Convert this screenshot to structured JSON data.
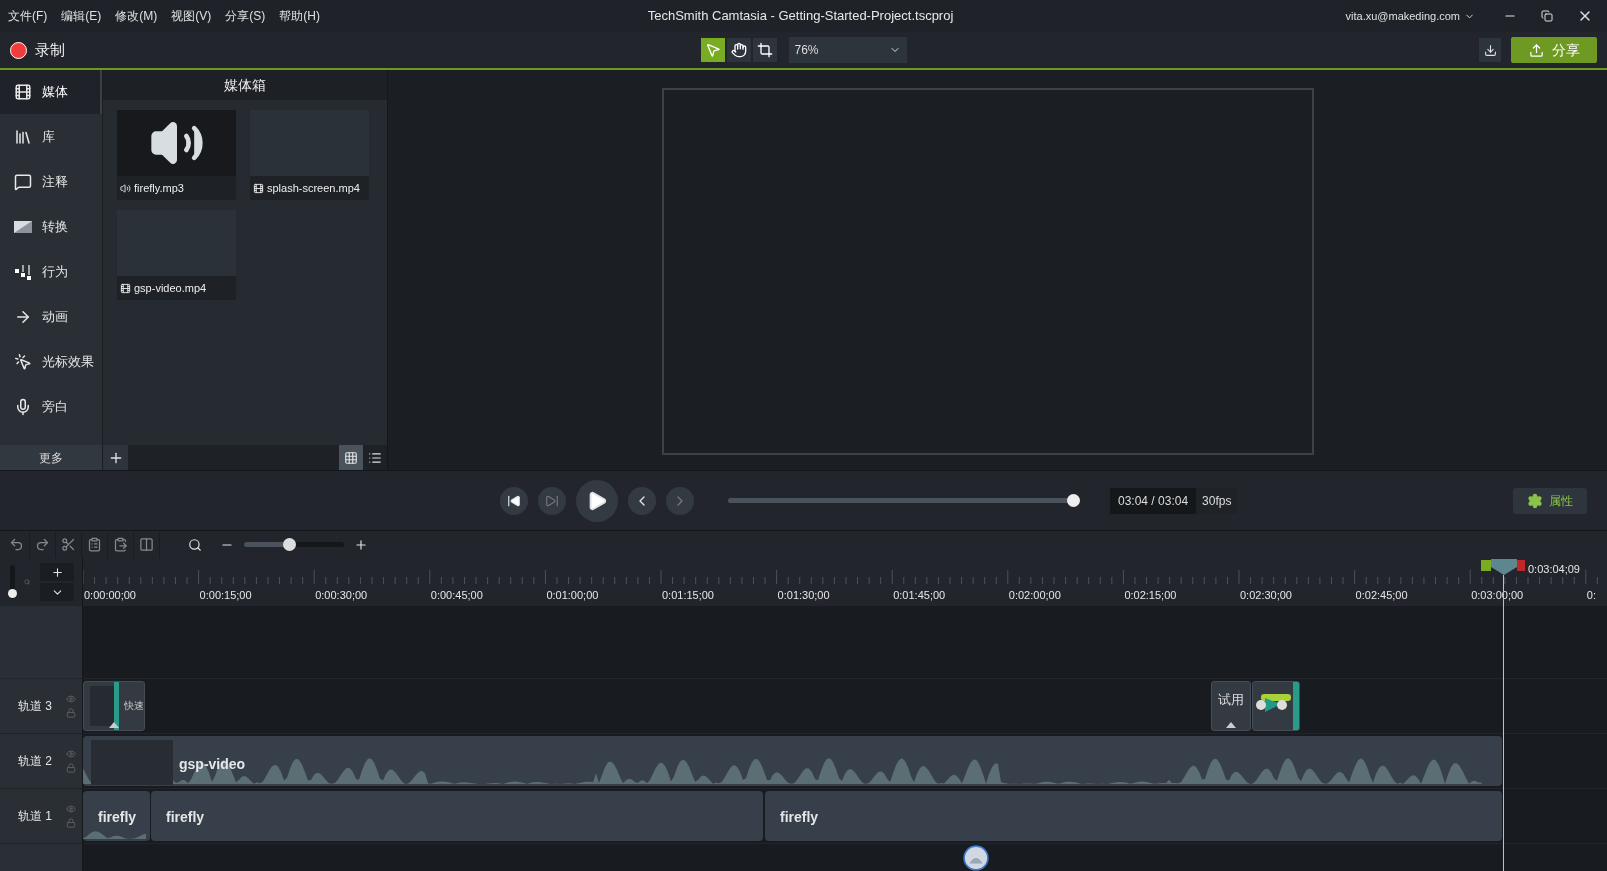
{
  "menu": [
    "文件(F)",
    "编辑(E)",
    "修改(M)",
    "视图(V)",
    "分享(S)",
    "帮助(H)"
  ],
  "window": {
    "title": "TechSmith Camtasia - Getting-Started-Project.tscproj",
    "account": "vita.xu@makeding.com"
  },
  "toolbar": {
    "record": "录制",
    "zoom": "76%",
    "share": "分享",
    "tools": [
      {
        "kind": "pointer",
        "selected": true
      },
      {
        "kind": "hand",
        "selected": false
      },
      {
        "kind": "crop",
        "selected": false
      }
    ]
  },
  "sidebar": {
    "items": [
      {
        "label": "媒体",
        "kind": "media",
        "selected": true
      },
      {
        "label": "库",
        "kind": "library",
        "selected": false
      },
      {
        "label": "注释",
        "kind": "annotation",
        "selected": false
      },
      {
        "label": "转换",
        "kind": "transition",
        "selected": false
      },
      {
        "label": "行为",
        "kind": "behavior",
        "selected": false
      },
      {
        "label": "动画",
        "kind": "animation",
        "selected": false
      },
      {
        "label": "光标效果",
        "kind": "cursor",
        "selected": false
      },
      {
        "label": "旁白",
        "kind": "narration",
        "selected": false
      }
    ],
    "more": "更多"
  },
  "media_bin": {
    "title": "媒体箱",
    "items": [
      {
        "name": "firefly.mp3",
        "kind": "audio"
      },
      {
        "name": "splash-screen.mp4",
        "kind": "video"
      },
      {
        "name": "gsp-video.mp4",
        "kind": "video"
      }
    ],
    "views": [
      {
        "kind": "grid",
        "selected": true
      },
      {
        "kind": "list",
        "selected": false
      }
    ]
  },
  "playback": {
    "level": 1,
    "time": "03:04 / 03:04",
    "fps": "30fps",
    "properties": "属性"
  },
  "timeline": {
    "zoom": {
      "level": 0.45
    },
    "track_height": {
      "level": 0.05
    },
    "ruler": [
      "0:00:00;00",
      "0:00:15;00",
      "0:00:30;00",
      "0:00:45;00",
      "0:01:00;00",
      "0:01:15;00",
      "0:01:30;00",
      "0:01:45;00",
      "0:02:00;00",
      "0:02:15;00",
      "0:02:30;00",
      "0:02:45;00",
      "0:03:00;00",
      "0:"
    ],
    "playhead": "0:03:04;09",
    "tracks": [
      {
        "name": "轨道 3",
        "clips": [
          {
            "kind": "callout",
            "label": "快速"
          },
          {
            "kind": "callout",
            "label": "试用"
          },
          {
            "kind": "behavior"
          }
        ]
      },
      {
        "name": "轨道 2",
        "clips": [
          {
            "kind": "video",
            "label": "gsp-video"
          }
        ]
      },
      {
        "name": "轨道 1",
        "clips": [
          {
            "kind": "audio",
            "label": "firefly"
          },
          {
            "kind": "audio",
            "label": "firefly"
          },
          {
            "kind": "audio",
            "label": "firefly"
          }
        ]
      }
    ]
  }
}
